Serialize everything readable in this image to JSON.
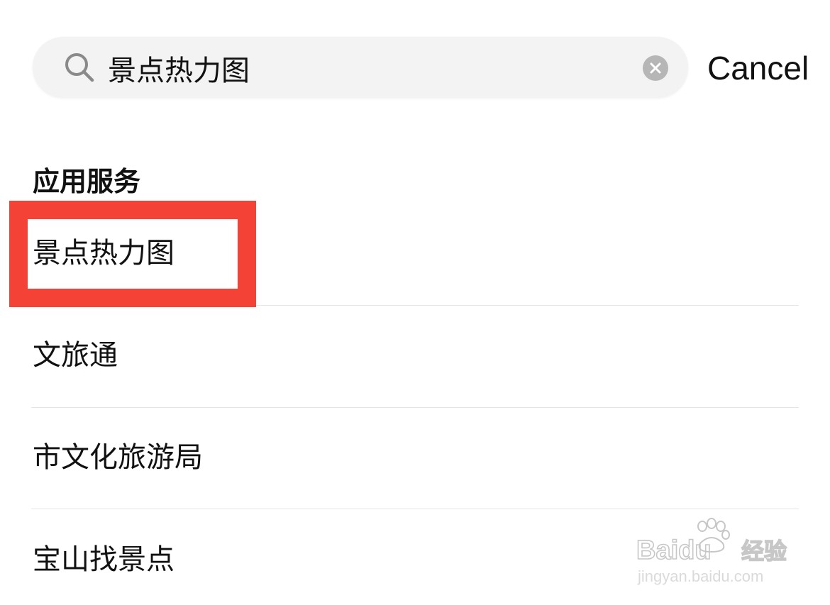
{
  "search": {
    "value": "景点热力图",
    "icon": "search-icon",
    "clear_icon": "clear-icon"
  },
  "header": {
    "cancel_label": "Cancel"
  },
  "section": {
    "title": "应用服务",
    "items": [
      {
        "label": "景点热力图",
        "highlighted": true
      },
      {
        "label": "文旅通"
      },
      {
        "label": "市文化旅游局"
      },
      {
        "label": "宝山找景点"
      }
    ]
  },
  "colors": {
    "highlight": "#f44336",
    "search_bg": "#f3f3f3",
    "clear_bg": "#b6b6b6"
  },
  "watermark": {
    "brand": "Baidu",
    "product": "经验",
    "url": "jingyan.baidu.com"
  }
}
